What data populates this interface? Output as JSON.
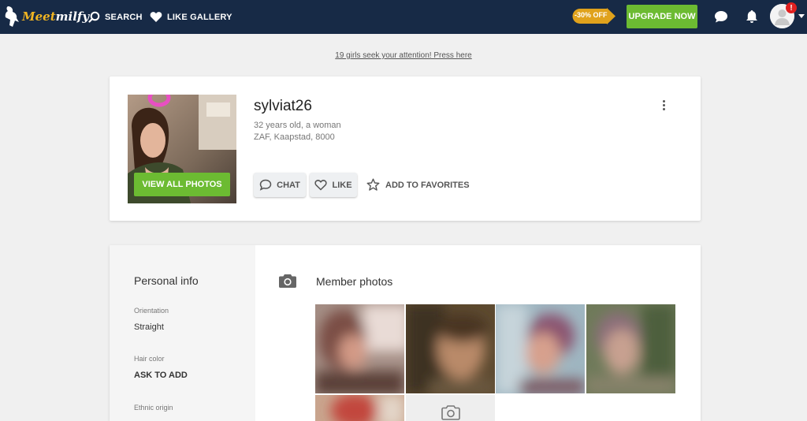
{
  "nav": {
    "logo_part1": "Meet",
    "logo_part2": "milfy",
    "search_label": "SEARCH",
    "like_gallery_label": "LIKE GALLERY",
    "promo_text": "-30% OFF",
    "upgrade_label": "UPGRADE NOW",
    "notification_badge": "!"
  },
  "attention_link": "19 girls seek your attention! Press here",
  "profile": {
    "username": "sylviat26",
    "age_gender": "32 years old, a woman",
    "location": "ZAF, Kaapstad, 8000",
    "view_all_photos_label": "VIEW ALL PHOTOS",
    "chat_label": "CHAT",
    "like_label": "LIKE",
    "add_favorites_label": "ADD TO FAVORITES"
  },
  "personal_info": {
    "title": "Personal info",
    "fields": [
      {
        "label": "Orientation",
        "value": "Straight"
      },
      {
        "label": "Hair color",
        "value": "ASK TO ADD"
      },
      {
        "label": "Ethnic origin",
        "value": ""
      }
    ]
  },
  "member_photos": {
    "title": "Member photos"
  },
  "colors": {
    "topbar": "#172a46",
    "accent_green": "#6cbb32",
    "promo_orange": "#e0a21c",
    "badge_red": "#e02020"
  }
}
